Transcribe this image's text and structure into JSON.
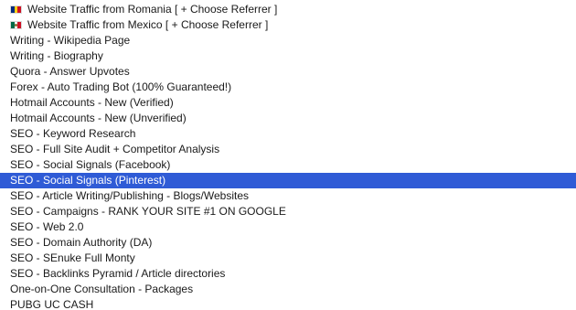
{
  "listbox": {
    "options": [
      {
        "label": "Website Traffic from Romania [ + Choose Referrer ]",
        "flag": "romania-flag-icon",
        "flag_colors": [
          "#002B7F",
          "#FCD116",
          "#CE1126"
        ]
      },
      {
        "label": "Website Traffic from Mexico [ + Choose Referrer ]",
        "flag": "mexico-flag-icon",
        "flag_colors": [
          "#006847",
          "#FFFFFF",
          "#CE1126"
        ]
      },
      {
        "label": "Writing - Wikipedia Page"
      },
      {
        "label": "Writing - Biography"
      },
      {
        "label": "Quora - Answer Upvotes"
      },
      {
        "label": "Forex - Auto Trading Bot (100% Guaranteed!)"
      },
      {
        "label": "Hotmail Accounts - New (Verified)"
      },
      {
        "label": "Hotmail Accounts - New (Unverified)"
      },
      {
        "label": "SEO - Keyword Research"
      },
      {
        "label": "SEO - Full Site Audit + Competitor Analysis"
      },
      {
        "label": "SEO - Social Signals (Facebook)"
      },
      {
        "label": "SEO - Social Signals (Pinterest)",
        "selected": true
      },
      {
        "label": "SEO - Article Writing/Publishing - Blogs/Websites"
      },
      {
        "label": "SEO - Campaigns - RANK YOUR SITE #1 ON GOOGLE"
      },
      {
        "label": "SEO - Web 2.0"
      },
      {
        "label": "SEO - Domain Authority (DA)"
      },
      {
        "label": "SEO - SEnuke Full Monty"
      },
      {
        "label": "SEO - Backlinks Pyramid / Article directories"
      },
      {
        "label": "One-on-One Consultation - Packages"
      },
      {
        "label": "PUBG UC CASH"
      }
    ],
    "selected_bg": "#2f5bd6",
    "selected_fg": "#ffffff",
    "text_color": "#1a1a1a"
  }
}
